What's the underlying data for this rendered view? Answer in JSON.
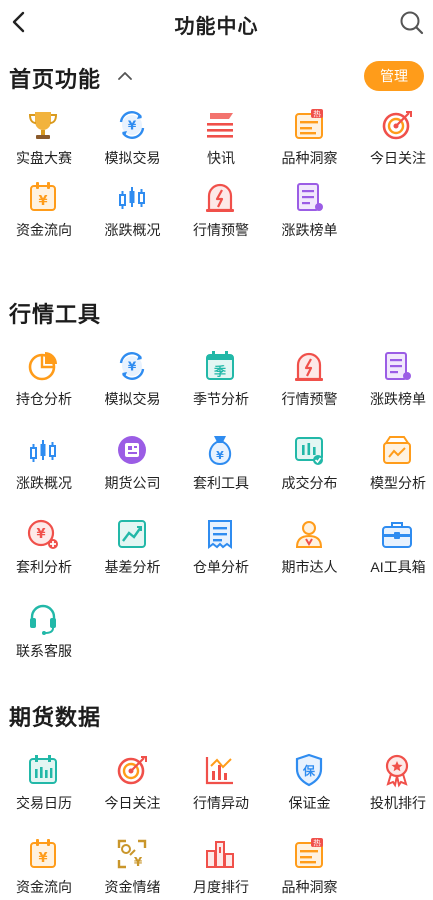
{
  "header": {
    "title": "功能中心",
    "back_icon": "back-arrow-icon",
    "search_icon": "search-icon"
  },
  "home": {
    "title": "首页功能",
    "manage_label": "管理",
    "items": [
      {
        "label": "实盘大赛",
        "icon": "trophy-icon"
      },
      {
        "label": "模拟交易",
        "icon": "yuan-exchange-icon"
      },
      {
        "label": "快讯",
        "icon": "flash-news-icon"
      },
      {
        "label": "品种洞察",
        "icon": "insight-hot-icon",
        "badge": "热"
      },
      {
        "label": "今日关注",
        "icon": "target-icon"
      },
      {
        "label": "资金流向",
        "icon": "fund-flow-icon"
      },
      {
        "label": "涨跌概况",
        "icon": "candlestick-icon"
      },
      {
        "label": "行情预警",
        "icon": "alarm-icon"
      },
      {
        "label": "涨跌榜单",
        "icon": "list-doc-icon"
      }
    ]
  },
  "tools": {
    "title": "行情工具",
    "items": [
      {
        "label": "持仓分析",
        "icon": "pie-chart-icon"
      },
      {
        "label": "模拟交易",
        "icon": "yuan-exchange-icon"
      },
      {
        "label": "季节分析",
        "icon": "season-calendar-icon",
        "glyph": "季"
      },
      {
        "label": "行情预警",
        "icon": "alarm-icon"
      },
      {
        "label": "涨跌榜单",
        "icon": "list-doc-icon"
      },
      {
        "label": "涨跌概况",
        "icon": "candlestick-icon"
      },
      {
        "label": "期货公司",
        "icon": "company-icon"
      },
      {
        "label": "套利工具",
        "icon": "money-bag-icon"
      },
      {
        "label": "成交分布",
        "icon": "distribution-icon"
      },
      {
        "label": "模型分析",
        "icon": "model-box-icon"
      },
      {
        "label": "套利分析",
        "icon": "yuan-plus-icon"
      },
      {
        "label": "基差分析",
        "icon": "basis-chart-icon"
      },
      {
        "label": "仓单分析",
        "icon": "receipt-icon"
      },
      {
        "label": "期市达人",
        "icon": "expert-icon"
      },
      {
        "label": "AI工具箱",
        "icon": "toolbox-icon"
      },
      {
        "label": "联系客服",
        "icon": "headset-icon"
      }
    ]
  },
  "data": {
    "title": "期货数据",
    "items": [
      {
        "label": "交易日历",
        "icon": "calendar-icon"
      },
      {
        "label": "今日关注",
        "icon": "target-icon"
      },
      {
        "label": "行情异动",
        "icon": "abnormal-chart-icon"
      },
      {
        "label": "保证金",
        "icon": "shield-icon",
        "glyph": "保"
      },
      {
        "label": "投机排行",
        "icon": "medal-icon"
      },
      {
        "label": "资金流向",
        "icon": "fund-flow-icon"
      },
      {
        "label": "资金情绪",
        "icon": "sentiment-icon"
      },
      {
        "label": "月度排行",
        "icon": "bar-rank-icon"
      },
      {
        "label": "品种洞察",
        "icon": "insight-hot-icon",
        "badge": "热"
      }
    ]
  },
  "colors": {
    "accent": "#ff9c1a",
    "blue": "#2f8cf0",
    "red": "#f0504a",
    "green": "#22b8a8",
    "purple": "#9b5de5",
    "orange": "#ff9c1a"
  }
}
